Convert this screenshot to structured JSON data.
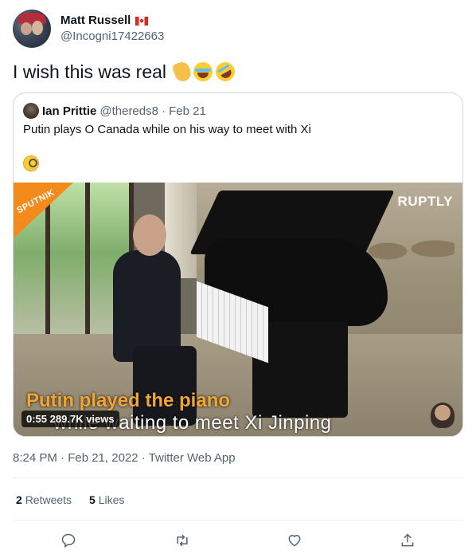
{
  "author": {
    "display_name": "Matt Russell",
    "handle": "@Incogni17422663",
    "flag_icon": "canada-flag-icon"
  },
  "tweet": {
    "text": "I wish this was real",
    "emojis": [
      "backhand-index-pointing-down-icon",
      "face-with-tears-of-joy-icon",
      "rolling-on-floor-laughing-icon"
    ]
  },
  "quoted": {
    "display_name": "Ian Prittie",
    "handle": "@thereds8",
    "date": "· Feb 21",
    "text": "Putin plays O Canada while on his way to meet with Xi",
    "emoji": "face-with-monocle-icon",
    "video": {
      "logo_left": "SPUTNIK",
      "logo_right": "RUPTLY",
      "caption_line1": "Putin played the piano",
      "caption_line2": "while waiting to meet Xi Jinping",
      "duration": "0:55",
      "views": "289.7K views"
    }
  },
  "meta": {
    "timestamp": "8:24 PM · Feb 21, 2022 · Twitter Web App"
  },
  "stats": {
    "retweets_count": "2",
    "retweets_label": "Retweets",
    "likes_count": "5",
    "likes_label": "Likes"
  },
  "colors": {
    "text": "#0f1419",
    "secondary": "#536471",
    "border": "#cfd9de",
    "caption_accent": "#f2a531",
    "sputnik_orange": "#f28b1c"
  }
}
